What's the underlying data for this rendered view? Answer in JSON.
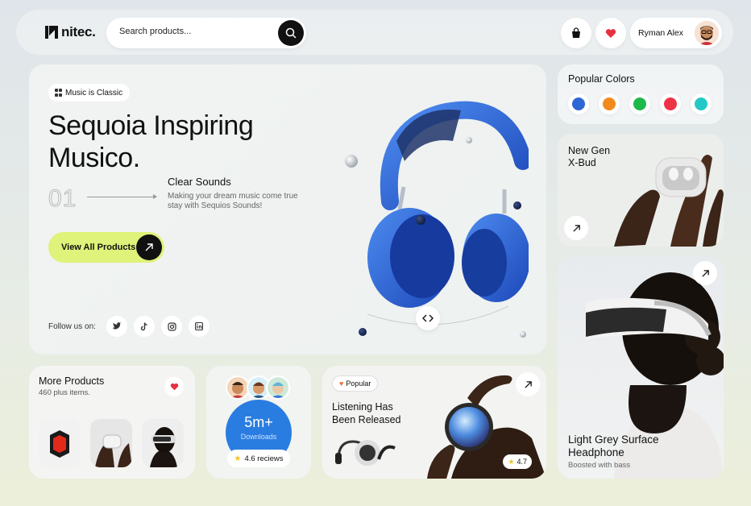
{
  "header": {
    "logo_text": "nitec.",
    "search_placeholder": "Search products...",
    "user_name": "Ryman Alex"
  },
  "hero": {
    "tag": "Music is Classic",
    "title_line1": "Sequoia Inspiring",
    "title_line2": "Musico.",
    "index": "01",
    "feature_title": "Clear Sounds",
    "feature_desc": "Making your dream music come true stay with Sequios Sounds!",
    "cta_label": "View All Products",
    "follow_label": "Follow us on:",
    "socials": [
      "twitter-icon",
      "tiktok-icon",
      "instagram-icon",
      "linkedin-icon"
    ]
  },
  "popular_colors": {
    "title": "Popular Colors",
    "colors": [
      "#2f66d6",
      "#f28a1c",
      "#1db94a",
      "#ee3344",
      "#24c9c6"
    ]
  },
  "xbud": {
    "title_line1": "New Gen",
    "title_line2": "X-Bud"
  },
  "vr_card": {
    "title_line1": "Light Grey Surface",
    "title_line2": "Headphone",
    "subtitle": "Boosted with bass"
  },
  "more_products": {
    "title": "More Products",
    "subtitle": "460 plus items."
  },
  "downloads": {
    "value": "5m+",
    "label": "Downloads",
    "reviews": "4.6 reciews"
  },
  "listening": {
    "tag": "Popular",
    "title_line1": "Listening Has",
    "title_line2": "Been Released",
    "rating": "4.7"
  },
  "theme": {
    "accent": "#dff279",
    "primary_blue": "#2a7de0",
    "dark": "#111111"
  }
}
